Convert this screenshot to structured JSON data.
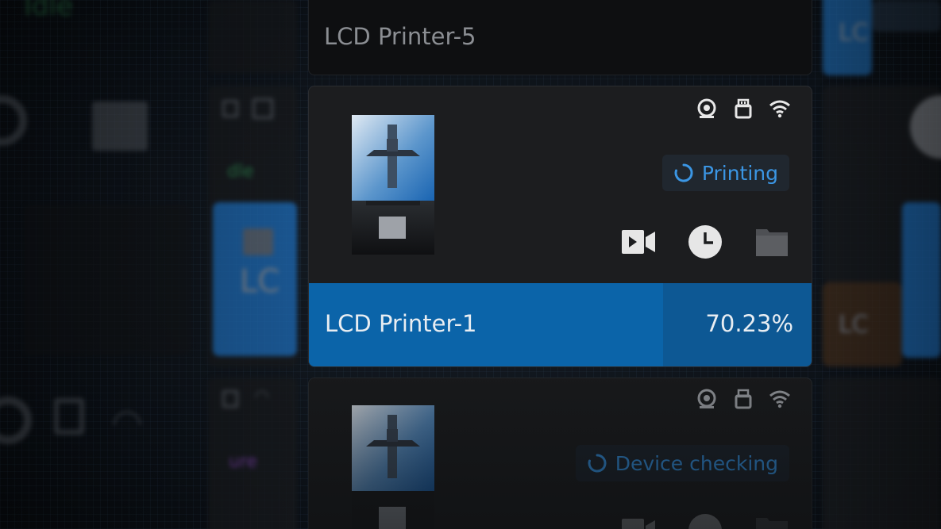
{
  "cards": {
    "top": {
      "name": "LCD Printer-5"
    },
    "main": {
      "status": "Printing",
      "printer_name": "LCD Printer-1",
      "progress_text": "70.23%",
      "progress": 0.7023,
      "status_icons": [
        "camera-icon",
        "usb-icon",
        "wifi-icon"
      ],
      "actions": [
        "video-icon",
        "clock-icon",
        "folder-icon"
      ]
    },
    "bottom": {
      "status": "Device checking",
      "status_icons": [
        "camera-icon",
        "usb-icon",
        "wifi-icon"
      ]
    }
  },
  "background": {
    "left": {
      "status_idle": "Idle",
      "status_partial": "dle",
      "label_partial": "LC",
      "status_failure_partial": "ure"
    },
    "right": {
      "label_partial_1": "LC",
      "label_partial_2": "LC"
    }
  },
  "colors": {
    "accent": "#0b64a9",
    "status_blue": "#3b96e4",
    "card_bg": "#1c1d1f",
    "idle_green": "#2e8a4e",
    "failure_purple": "#7a3ea8",
    "orange_card": "#5a3a1a"
  }
}
